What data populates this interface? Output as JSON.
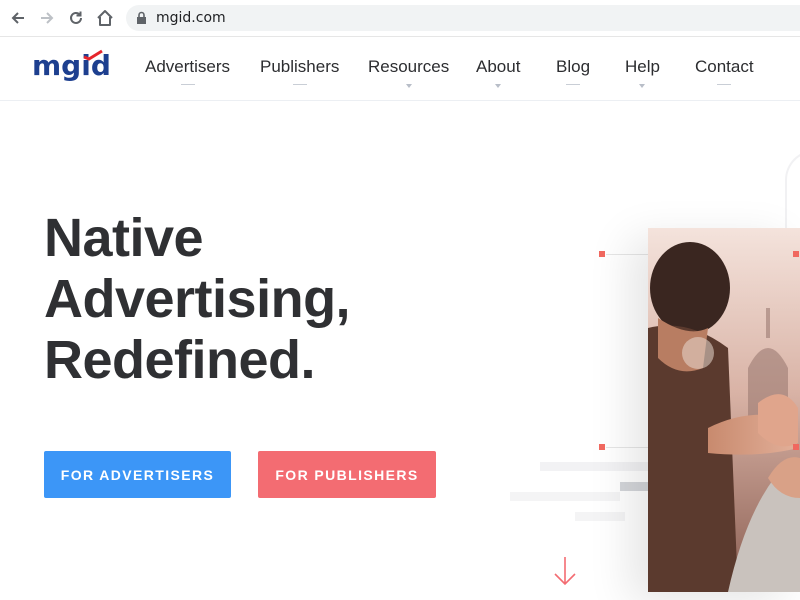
{
  "browser": {
    "url": "mgid.com",
    "icons": [
      "back-arrow-icon",
      "forward-arrow-icon",
      "reload-icon",
      "home-icon",
      "lock-icon"
    ]
  },
  "site": {
    "logo_text": "mgid",
    "nav": [
      {
        "label": "Advertisers"
      },
      {
        "label": "Publishers"
      },
      {
        "label": "Resources"
      },
      {
        "label": "About"
      },
      {
        "label": "Blog"
      },
      {
        "label": "Help"
      },
      {
        "label": "Contact"
      }
    ]
  },
  "hero": {
    "title_lines": [
      "Native",
      "Advertising,",
      "Redefined."
    ],
    "cta_advertisers": "FOR ADVERTISERS",
    "cta_publishers": "FOR PUBLISHERS"
  },
  "colors": {
    "brand_blue": "#1d3f8f",
    "cta_blue": "#3c96f7",
    "cta_red": "#f36c72",
    "accent_red": "#f0685f",
    "text_dark": "#2f3033"
  }
}
